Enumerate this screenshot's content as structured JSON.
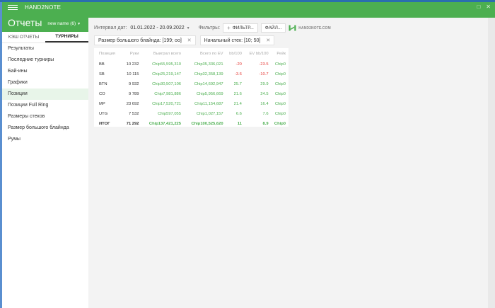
{
  "app": {
    "name": "HAND2NOTE"
  },
  "header": {
    "title": "Отчеты",
    "report_name": "new name (6)"
  },
  "window_controls": {
    "restore_icon": "□",
    "close_icon": "✕"
  },
  "sidebar": {
    "tabs": [
      {
        "label": "КЭШ ОТЧЕТЫ"
      },
      {
        "label": "ТУРНИРЫ",
        "active": true
      }
    ],
    "items": [
      {
        "label": "Результаты"
      },
      {
        "label": "Последние турниры"
      },
      {
        "label": "Бай-ины"
      },
      {
        "label": "Графики"
      },
      {
        "label": "Позиции",
        "active": true
      },
      {
        "label": "Позиции Full Ring"
      },
      {
        "label": "Размеры стеков"
      },
      {
        "label": "Размер большого блайнда"
      },
      {
        "label": "Румы"
      }
    ]
  },
  "filterbar": {
    "date_label": "Интервал дат:",
    "date_value": "01.01.2022 - 20.09.2022",
    "filters_label": "Фильтры:",
    "add_filter": "ФИЛЬТР...",
    "file_button": "ФАЙЛ...",
    "logo_text": "HAND2NOTE.COM"
  },
  "chips": [
    {
      "label": "Размер большого блайнда: [199; oo]"
    },
    {
      "label": "Начальный стек: [10; 50]"
    }
  ],
  "table": {
    "columns": [
      "Позиция",
      "Руки",
      "Выиграл всего",
      "Всего по EV",
      "bb/100",
      "EV bb/100",
      "Рейк"
    ],
    "rows": [
      [
        "BB",
        "10 232",
        "Chip55,595,310",
        "Chip35,336,021",
        "-20",
        "-23.5",
        "Chip0"
      ],
      [
        "SB",
        "10 115",
        "Chip25,219,147",
        "Chip32,358,139",
        "-3.6",
        "-10.7",
        "Chip0"
      ],
      [
        "BTN",
        "9 932",
        "Chip30,507,106",
        "Chip14,692,947",
        "25.7",
        "29.9",
        "Chip0"
      ],
      [
        "CO",
        "9 789",
        "Chip7,981,886",
        "Chip5,956,669",
        "21.6",
        "24.5",
        "Chip0"
      ],
      [
        "MP",
        "23 692",
        "Chip17,520,721",
        "Chip11,154,687",
        "21.4",
        "16.4",
        "Chip0"
      ],
      [
        "UTG",
        "7 532",
        "Chip597,055",
        "Chip1,027,157",
        "6.6",
        "7.6",
        "Chip0"
      ]
    ],
    "total": [
      "ИТОГ",
      "71 292",
      "Chip137,421,225",
      "Chip100,525,620",
      "11",
      "8.9",
      "Chip0"
    ]
  },
  "colors": {
    "accent": "#4caf50",
    "negative": "#e53935",
    "window_border": "#2a6fae"
  }
}
